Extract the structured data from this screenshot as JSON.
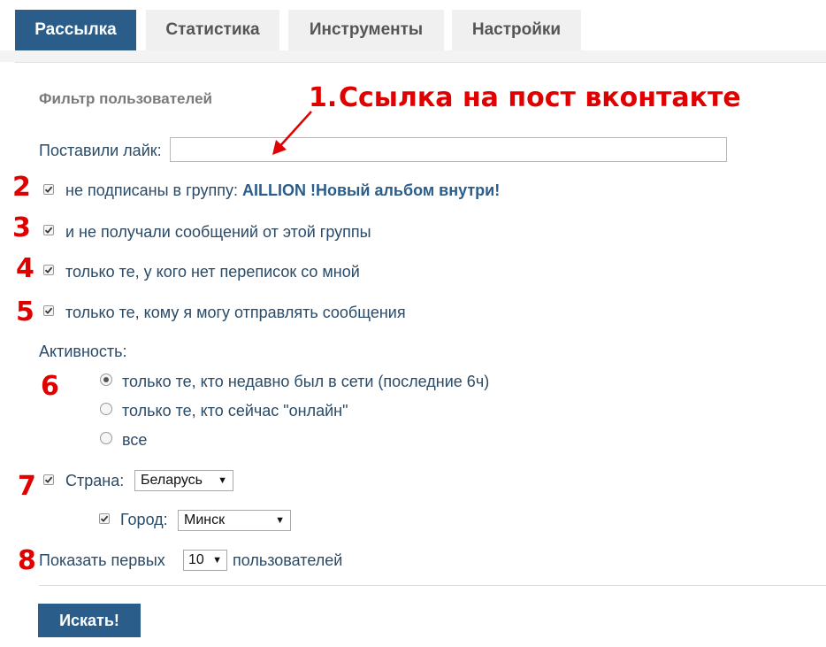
{
  "tabs": [
    {
      "label": "Рассылка",
      "active": true
    },
    {
      "label": "Статистика",
      "active": false
    },
    {
      "label": "Инструменты",
      "active": false
    },
    {
      "label": "Настройки",
      "active": false
    }
  ],
  "filter": {
    "title": "Фильтр пользователей",
    "liked_label": "Поставили лайк:",
    "liked_value": "",
    "not_subscribed_prefix": "не подписаны в группу:",
    "group_name": "AILLION !Новый альбом внутри!",
    "no_messages_label": "и не получали сообщений от этой группы",
    "no_dialogs_label": "только те, у кого нет переписок со мной",
    "can_message_label": "только те, кому я могу отправлять сообщения",
    "activity_label": "Активность:",
    "activity_options": [
      {
        "label": "только те, кто недавно был в сети (последние 6ч)",
        "checked": true
      },
      {
        "label": "только те, кто сейчас \"онлайн\"",
        "checked": false
      },
      {
        "label": "все",
        "checked": false
      }
    ],
    "country_label": "Страна:",
    "country_value": "Беларусь",
    "city_label": "Город:",
    "city_value": "Минск",
    "show_first_label": "Показать первых",
    "show_first_value": "10",
    "users_label": "пользователей",
    "search_button": "Искать!"
  },
  "annotations": {
    "title": "Ссылка на пост вконтакте",
    "numbers": [
      "1.",
      "2",
      "3",
      "4",
      "5",
      "6",
      "7",
      "8"
    ],
    "color": "#e00000"
  },
  "colors": {
    "accent": "#2b5d8a",
    "tab_inactive": "#f0f0f0",
    "text": "#2a4a66"
  }
}
